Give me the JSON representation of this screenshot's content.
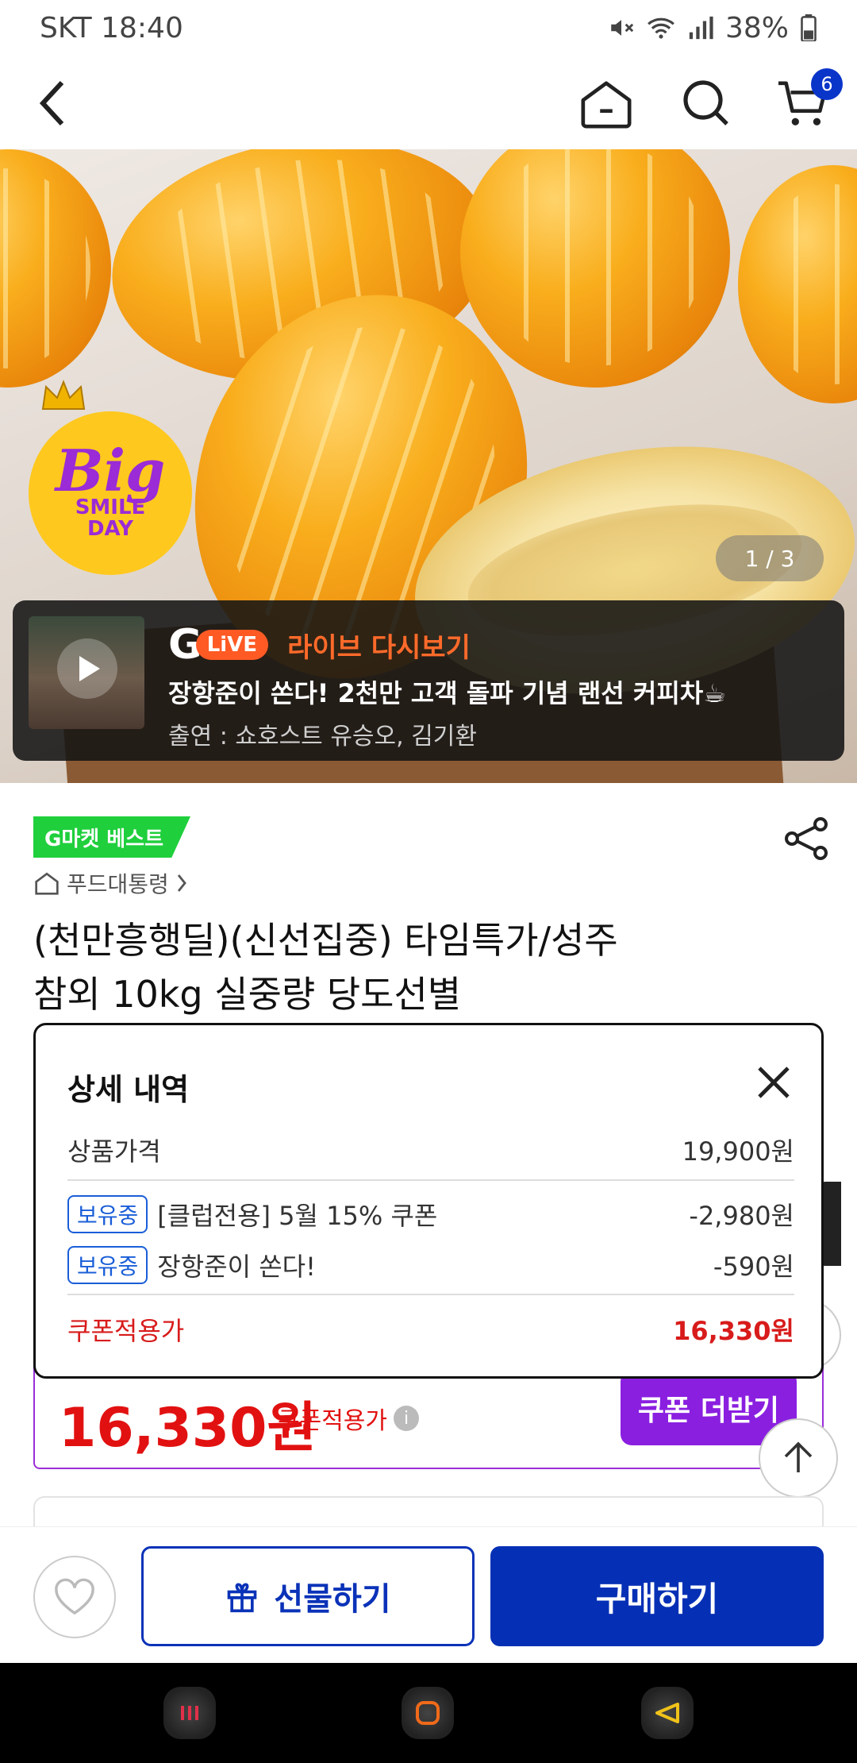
{
  "status": {
    "carrier_time": "SKT 18:40",
    "battery": "38%"
  },
  "nav": {
    "cart_count": "6"
  },
  "hero": {
    "badge_big": "Big",
    "badge_smile": "SMILE",
    "badge_day": "DAY",
    "pager": "1 / 3",
    "live": {
      "logo": "G",
      "pill": "LiVE",
      "label": "라이브 다시보기",
      "title": "장항준이 쏜다! 2천만 고객 돌파 기념 랜선 커피차☕",
      "cast": "출연 : 쇼호스트 유승오, 김기환"
    }
  },
  "product": {
    "best_badge": "G마켓 베스트",
    "breadcrumb": "푸드대통령",
    "title_line1": "(천만흥행딜)(신선집중) 타임특가/성주",
    "title_line2": "참외 10kg 실중량 당도선별",
    "price": "16,330원",
    "price_note": "쿠폰적용가",
    "coupon_more": "쿠폰 더받기"
  },
  "popup": {
    "title": "상세 내역",
    "base_label": "상품가격",
    "base_value": "19,900원",
    "coupons": [
      {
        "tag": "보유중",
        "label": "[클럽전용] 5월 15% 쿠폰",
        "value": "-2,980원"
      },
      {
        "tag": "보유중",
        "label": "장항준이 쏜다!",
        "value": "-590원"
      }
    ],
    "total_label": "쿠폰적용가",
    "total_value": "16,330원"
  },
  "bottom": {
    "gift": "선물하기",
    "buy": "구매하기"
  },
  "colors": {
    "primary": "#0530b5",
    "price_red": "#e21111",
    "accent_purple": "#8a1fe0",
    "best_green": "#1fcf3c"
  }
}
